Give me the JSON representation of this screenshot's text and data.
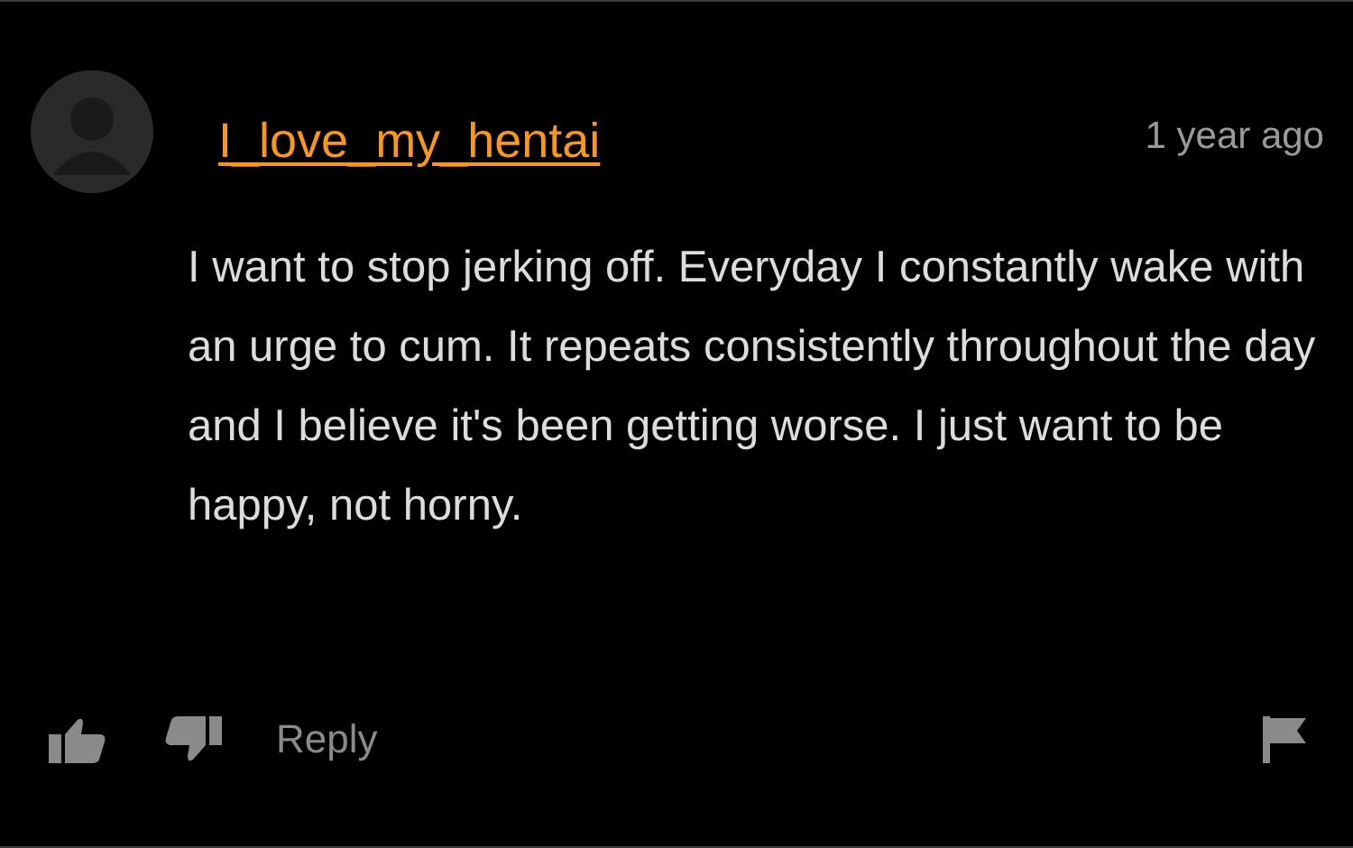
{
  "comment": {
    "username": "I_love_my_hentai",
    "time": "1 year ago",
    "text": "I want to stop jerking off. Everyday I constantly wake with an urge to cum. It repeats consistently throughout the day and I believe it's been getting worse. I just want to be happy, not horny.",
    "reply": "Reply"
  }
}
